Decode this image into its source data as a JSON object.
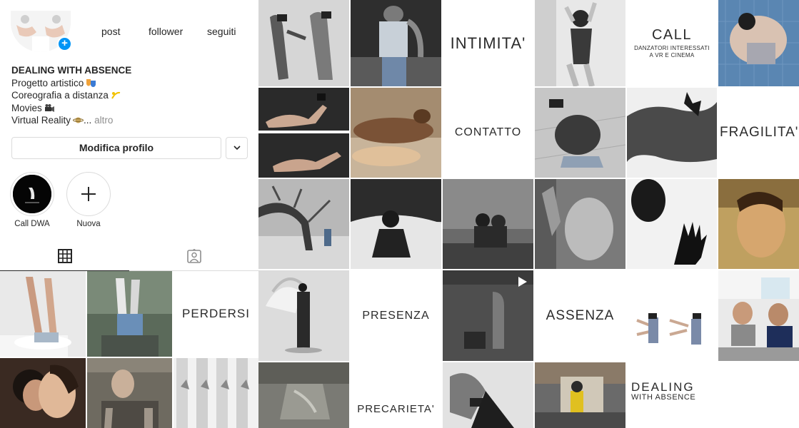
{
  "profile": {
    "stats": {
      "posts_label": "post",
      "followers_label": "follower",
      "following_label": "seguiti"
    },
    "bio": {
      "name": "DEALING WITH ABSENCE",
      "line1": "Progetto artistico",
      "line2": "Coreografia a distanza",
      "line3": "Movies",
      "line4": "Virtual Reality",
      "ellipsis": "...",
      "more": "altro"
    },
    "edit_button": "Modifica profilo",
    "highlights": [
      {
        "label": "Call DWA"
      },
      {
        "label": "Nuova"
      }
    ],
    "tabs": {
      "grid_icon": "grid-icon",
      "tagged_icon": "tagged-user-icon"
    },
    "accent_color": "#0095f6",
    "posts": [
      {
        "text": ""
      },
      {
        "text": ""
      },
      {
        "text": "PERDERSI"
      },
      {
        "text": ""
      },
      {
        "text": ""
      },
      {
        "text": ""
      }
    ]
  },
  "grid": {
    "tiles": [
      {
        "text": ""
      },
      {
        "text": ""
      },
      {
        "text": "INTIMITA'"
      },
      {
        "text": ""
      },
      {
        "title": "CALL",
        "subtitle": "DANZATORI INTERESSATI\nA VR E CINEMA"
      },
      {
        "text": ""
      },
      {
        "text": ""
      },
      {
        "text": ""
      },
      {
        "text": "CONTATTO"
      },
      {
        "text": ""
      },
      {
        "text": ""
      },
      {
        "text": "FRAGILITA'"
      },
      {
        "text": ""
      },
      {
        "text": ""
      },
      {
        "text": ""
      },
      {
        "text": ""
      },
      {
        "text": ""
      },
      {
        "text": ""
      },
      {
        "text": ""
      },
      {
        "text": "PRESENZA"
      },
      {
        "text": ""
      },
      {
        "text": "ASSENZA"
      },
      {
        "text": ""
      },
      {
        "text": ""
      },
      {
        "text": ""
      },
      {
        "text": "PRECARIETA'"
      },
      {
        "text": ""
      },
      {
        "text": ""
      },
      {
        "title": "DEALING",
        "subtitle": "WITH ABSENCE"
      }
    ]
  }
}
